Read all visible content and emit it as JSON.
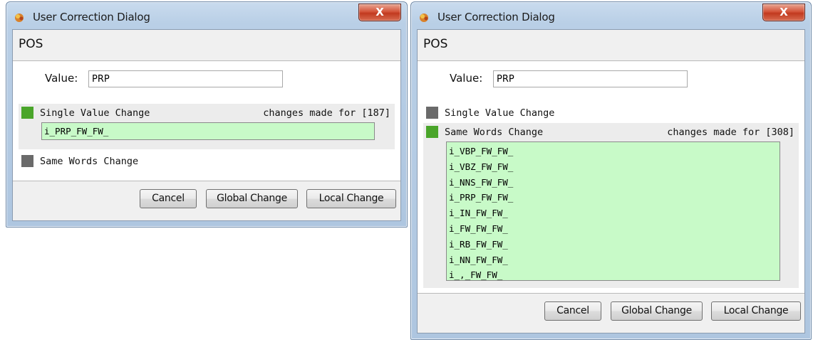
{
  "left_dialog": {
    "title": "User Correction Dialog",
    "close_label": "X",
    "header": "POS",
    "value_label": "Value:",
    "value": "PRP",
    "single_value_section": {
      "label": "Single Value Change",
      "changes": "changes made for [187]",
      "items": [
        "i_PRP_FW_FW_"
      ]
    },
    "same_words_section": {
      "label": "Same Words Change"
    },
    "buttons": {
      "cancel": "Cancel",
      "global": "Global Change",
      "local": "Local Change"
    }
  },
  "right_dialog": {
    "title": "User Correction Dialog",
    "close_label": "X",
    "header": "POS",
    "value_label": "Value:",
    "value": "PRP",
    "single_value_section": {
      "label": "Single Value Change"
    },
    "same_words_section": {
      "label": "Same Words Change",
      "changes": "changes made for [308]",
      "items": [
        "i_VBP_FW_FW_",
        "i_VBZ_FW_FW_",
        "i_NNS_FW_FW_",
        "i_PRP_FW_FW_",
        "i_IN_FW_FW_",
        "i_FW_FW_FW_",
        "i_RB_FW_FW_",
        "i_NN_FW_FW_",
        "i_,_FW_FW_"
      ]
    },
    "buttons": {
      "cancel": "Cancel",
      "global": "Global Change",
      "local": "Local Change"
    }
  },
  "colors": {
    "active_indicator": "#4aa52a",
    "inactive_indicator": "#6a6a6a",
    "list_background": "#c8fac8"
  }
}
